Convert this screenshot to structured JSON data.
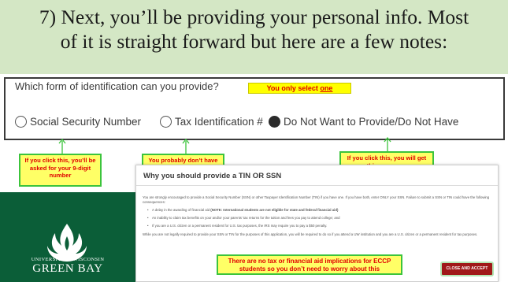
{
  "slide": {
    "title": "7) Next, you’ll be providing your personal info. Most\nof it is straight forward but here are a few notes:"
  },
  "form": {
    "question": "Which form of identification can you provide?",
    "note_prefix": "You only select ",
    "note_emphasis": "one",
    "options": [
      {
        "label": "Social Security Number",
        "selected": false
      },
      {
        "label": "Tax Identification #",
        "selected": false
      },
      {
        "label": "Do Not Want to Provide/Do Not Have",
        "selected": true
      }
    ]
  },
  "callouts": {
    "ssn": "If you click this, you’ll be asked for your 9-digit number",
    "tin": "You probably don’t have one of these",
    "no_provide": "If you click this, you will get this message:",
    "bottom": "There are no tax or financial aid implications for ECCP students so you don’t need to worry about this"
  },
  "modal": {
    "title": "Why you should provide a TIN OR SSN",
    "intro": "You are strongly encouraged to provide a Social Security Number (SSN) or other Taxpayer Identification Number (TIN) if you have one. If you have both, enter ONLY your SSN. Failure to submit a SSN or TIN could have the following consequences:",
    "bullets": [
      {
        "prefix": "A delay in the awarding of financial aid ",
        "bold": "(NOTE: International students are not eligible for state and federal financial aid)",
        "suffix": ""
      },
      {
        "prefix": "An inability to claim tax benefits on your and/or your parents' tax returns for the tuition and fees you pay to attend college; and",
        "bold": "",
        "suffix": ""
      },
      {
        "prefix": "If you are a U.S. citizen or a permanent resident for U.S. tax purposes, the IRS may require you to pay a $50 penalty.",
        "bold": "",
        "suffix": ""
      }
    ],
    "outro": "While you are not legally required to provide your SSN or TIN for the purposes of this application, you will be required to do so if you attend a UW institution and you are a U.S. citizen or a permanent resident for tax purposes.",
    "close_label": "CLOSE AND ACCEPT"
  },
  "brand": {
    "university_small": "UNIVERSITY of WISCONSIN",
    "university_big": "GREEN BAY",
    "logo_icon": "phoenix-flame-icon",
    "colors": {
      "green": "#0b5e38",
      "title_bg": "#d4e7c5",
      "callout_bg": "#ffff66",
      "callout_text": "#e00000",
      "button": "#a01919"
    }
  }
}
